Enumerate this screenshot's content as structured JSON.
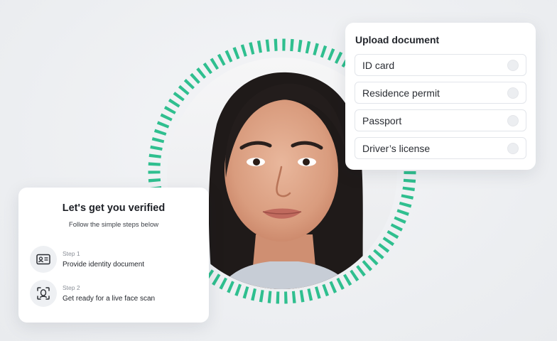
{
  "upload": {
    "title": "Upload document",
    "options": [
      {
        "label": "ID card"
      },
      {
        "label": "Residence permit"
      },
      {
        "label": "Passport"
      },
      {
        "label": "Driver’s license"
      }
    ]
  },
  "verify": {
    "title": "Let's get you verified",
    "subtitle": "Follow the simple steps below",
    "steps": [
      {
        "label": "Step 1",
        "description": "Provide identity document",
        "icon": "id-card-icon"
      },
      {
        "label": "Step 2",
        "description": "Get ready for a live face scan",
        "icon": "face-scan-icon"
      }
    ]
  },
  "colors": {
    "accent": "#2fbf8f",
    "card": "#ffffff",
    "background": "#eef0f3"
  }
}
